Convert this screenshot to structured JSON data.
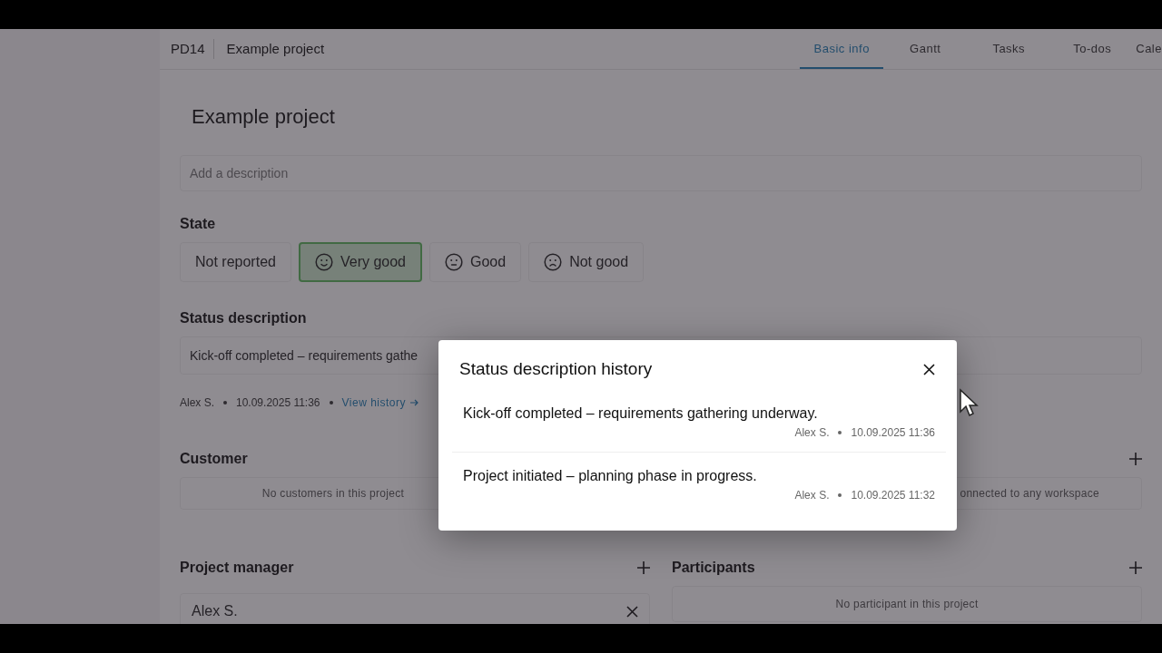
{
  "header": {
    "code": "PD14",
    "project": "Example project"
  },
  "tabs": [
    {
      "label": "Basic info",
      "selected": true
    },
    {
      "label": "Gantt",
      "selected": false
    },
    {
      "label": "Tasks",
      "selected": false
    },
    {
      "label": "To-dos",
      "selected": false
    },
    {
      "label": "Cale",
      "selected": false
    }
  ],
  "title": "Example project",
  "description": {
    "placeholder": "Add a description"
  },
  "state": {
    "label": "State",
    "options": [
      {
        "label": "Not reported",
        "kind": "none",
        "selected": false
      },
      {
        "label": "Very good",
        "kind": "smile",
        "selected": true
      },
      {
        "label": "Good",
        "kind": "neutral",
        "selected": false
      },
      {
        "label": "Not good",
        "kind": "frown",
        "selected": false
      }
    ]
  },
  "status_description": {
    "label": "Status description",
    "value": "Kick-off completed – requirements gathe",
    "author": "Alex S.",
    "time": "10.09.2025 11:36",
    "history_link": "View history"
  },
  "customer": {
    "title": "Customer",
    "empty": "No customers in this project"
  },
  "workspace": {
    "empty": "onnected to any workspace"
  },
  "project_manager": {
    "title": "Project manager",
    "people": [
      "Alex S."
    ]
  },
  "participants": {
    "title": "Participants",
    "empty": "No participant in this project"
  },
  "modal": {
    "title": "Status description history",
    "entries": [
      {
        "text": "Kick-off completed – requirements gathering underway.",
        "author": "Alex S.",
        "time": "10.09.2025 11:36"
      },
      {
        "text": "Project initiated – planning phase in progress.",
        "author": "Alex S.",
        "time": "10.09.2025 11:32"
      }
    ]
  }
}
